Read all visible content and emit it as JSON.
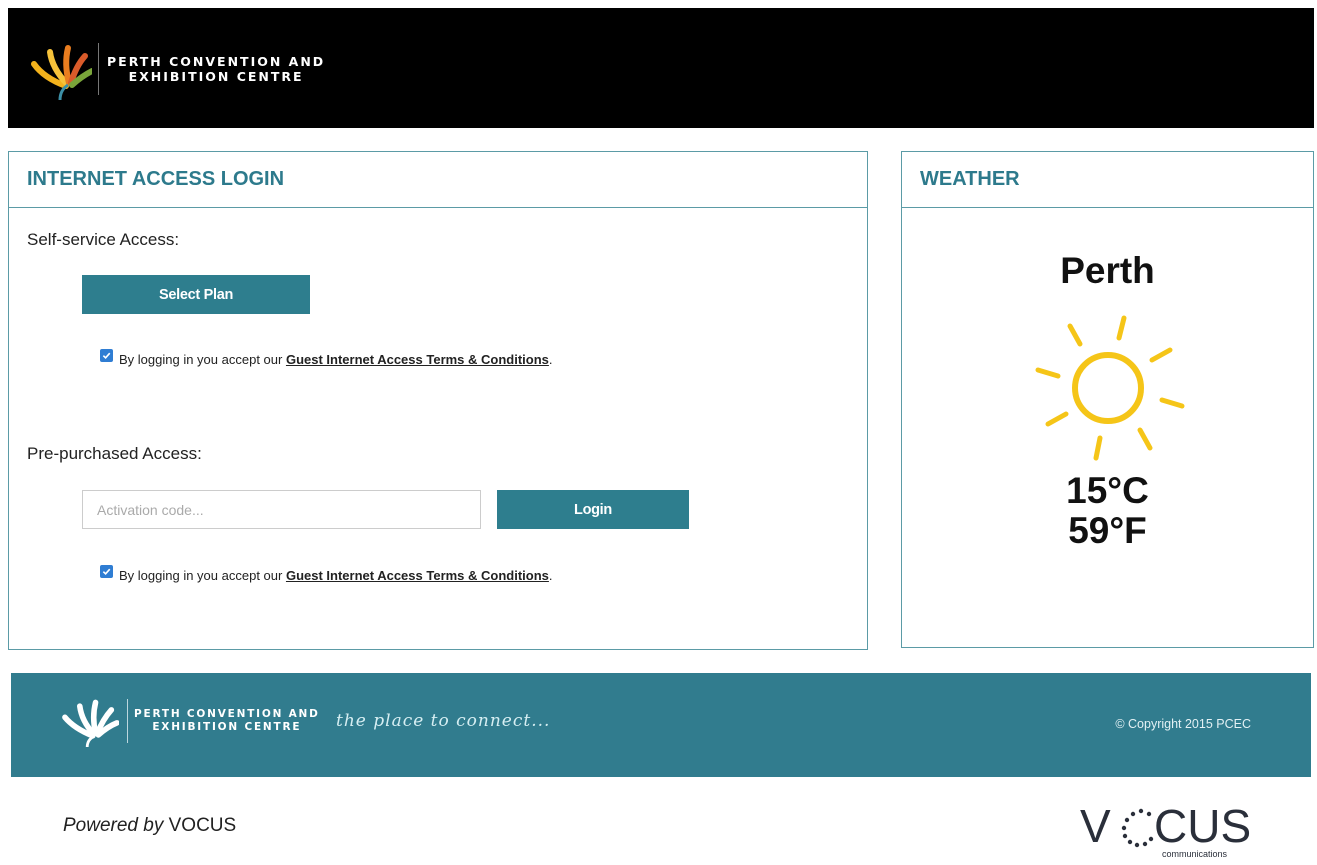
{
  "header": {
    "logo_line1": "PERTH CONVENTION AND",
    "logo_line2": "EXHIBITION CENTRE"
  },
  "login": {
    "title": "INTERNET ACCESS LOGIN",
    "self_service_label": "Self-service Access:",
    "select_plan_label": "Select Plan",
    "terms_prefix": "By logging in you accept our ",
    "terms_link": "Guest Internet Access Terms & Conditions",
    "terms_suffix": ".",
    "prepurchased_label": "Pre-purchased Access:",
    "activation_placeholder": "Activation code...",
    "login_label": "Login",
    "self_service_terms_checked": true,
    "prepurchased_terms_checked": true
  },
  "weather": {
    "title": "WEATHER",
    "city": "Perth",
    "icon": "sun-icon",
    "temp_c": "15°C",
    "temp_f": "59°F"
  },
  "footer": {
    "logo_line1": "PERTH CONVENTION AND",
    "logo_line2": "EXHIBITION CENTRE",
    "tagline": "the place to connect...",
    "copyright": "© Copyright 2015 PCEC"
  },
  "powered": {
    "prefix": "Powered by ",
    "brand": "VOCUS"
  },
  "vocus_logo": {
    "letter_v": "V",
    "letters_cus": "CUS",
    "subtitle": "communications"
  },
  "colors": {
    "accent": "#2e7e8e",
    "header_bg": "#000000",
    "panel_border": "#5b9ba6",
    "checkbox": "#2f7dd3",
    "sun": "#f5c518"
  }
}
